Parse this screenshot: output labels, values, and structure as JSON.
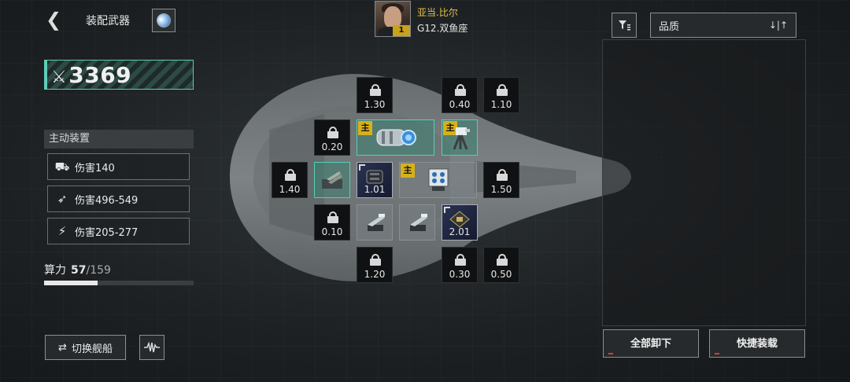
{
  "header": {
    "back_glyph": "❮",
    "title": "装配武器",
    "planet_icon": "planet-icon"
  },
  "pilot": {
    "name": "亚当.比尔",
    "ship": "G12.双鱼座",
    "level": "1"
  },
  "filter": {
    "icon": "filter-icon",
    "sort_label": "品质",
    "sort_arrows": "↓|↑"
  },
  "power": {
    "value": "3369"
  },
  "active_devices": {
    "title": "主动装置",
    "items": [
      {
        "icon": "artillery-icon",
        "label": "伤害140"
      },
      {
        "icon": "missile-icon",
        "label": "伤害496-549"
      },
      {
        "icon": "laser-icon",
        "label": "伤害205-277"
      }
    ]
  },
  "compute": {
    "label": "算力",
    "used": "57",
    "total": "/159",
    "fraction": 0.358
  },
  "buttons": {
    "switch_ship": "切换舰船",
    "switch_glyph": "⇄",
    "wave_glyph": "⌇",
    "unload_all": "全部卸下",
    "quick_load": "快捷装载"
  },
  "main_tag": "主",
  "slots": {
    "locked": [
      {
        "id": "r0c1",
        "value": "1.30"
      },
      {
        "id": "r0c3",
        "value": "0.40"
      },
      {
        "id": "r0c4",
        "value": "1.10"
      },
      {
        "id": "r1c0",
        "value": "0.20"
      },
      {
        "id": "r2m1",
        "value": "1.40"
      },
      {
        "id": "r2c4",
        "value": "1.50"
      },
      {
        "id": "r3c0",
        "value": "0.10"
      },
      {
        "id": "r4c1",
        "value": "1.20"
      },
      {
        "id": "r4c3",
        "value": "0.30"
      },
      {
        "id": "r4c4",
        "value": "0.50"
      }
    ],
    "equipped": [
      {
        "id": "cannon-main",
        "tag": true,
        "value": ""
      },
      {
        "id": "turret-main",
        "tag": true,
        "value": ""
      },
      {
        "id": "turret-teal",
        "tag": false,
        "value": ""
      },
      {
        "id": "missile-pod",
        "tag": false,
        "value": "1.01"
      },
      {
        "id": "box-launcher-main",
        "tag": true,
        "value": ""
      },
      {
        "id": "gun-a",
        "tag": false,
        "value": ""
      },
      {
        "id": "gun-b",
        "tag": false,
        "value": ""
      },
      {
        "id": "mine-device",
        "tag": false,
        "value": "2.01"
      }
    ]
  }
}
